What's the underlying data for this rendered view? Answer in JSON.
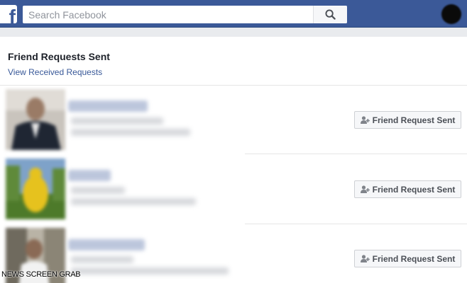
{
  "app": {
    "logo_letter": "f",
    "brand_color": "#3b5998",
    "link_color": "#385898"
  },
  "search": {
    "placeholder": "Search Facebook",
    "icon": "search-icon"
  },
  "page": {
    "title": "Friend Requests Sent",
    "received_link": "View Received Requests"
  },
  "requests": [
    {
      "button_label": "Friend Request Sent",
      "button_icon": "user-added-icon",
      "name_blurred": true,
      "photo": "man-in-suit"
    },
    {
      "button_label": "Friend Request Sent",
      "button_icon": "user-added-icon",
      "name_blurred": true,
      "photo": "yellow-figure-on-grass"
    },
    {
      "button_label": "Friend Request Sent",
      "button_icon": "user-added-icon",
      "name_blurred": true,
      "photo": "person-outdoors"
    }
  ],
  "watermark": "NEWS SCREEN GRAB"
}
